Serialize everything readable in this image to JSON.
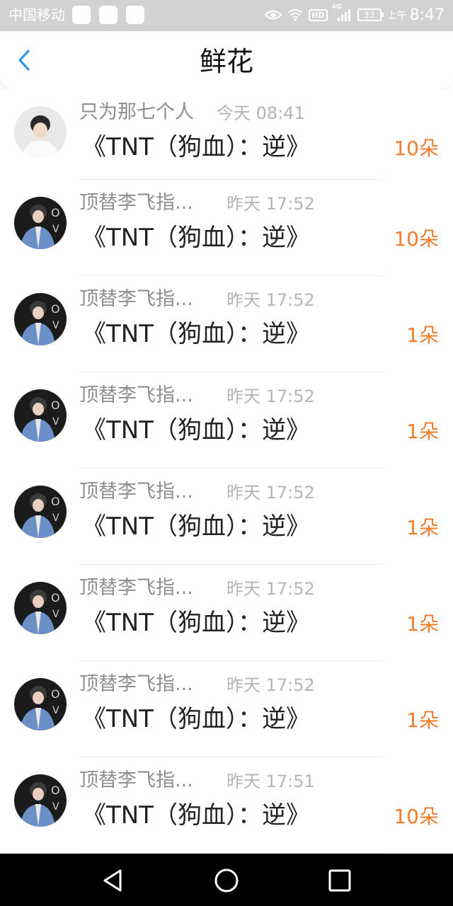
{
  "status_bar": {
    "carrier": "中国移动",
    "hd_badge": "HD",
    "network": "4G",
    "battery": "33",
    "ampm": "上午",
    "time": "8:47",
    "icons": [
      "notification-square-icon",
      "eye-icon",
      "wifi-icon",
      "signal-icon",
      "battery-icon"
    ]
  },
  "header": {
    "title": "鲜花",
    "back_icon": "chevron-left-icon"
  },
  "colors": {
    "accent_blue": "#2b9af3",
    "count_orange": "#f07c2c",
    "status_bar_bg": "#d2d2d2",
    "nav_bar_bg": "#000000"
  },
  "records": [
    {
      "name": "只为那七个人",
      "time": "今天 08:41",
      "work": "《TNT（狗血）：逆》",
      "count": "10朵",
      "avatar": "light"
    },
    {
      "name": "顶替李飞指...",
      "time": "昨天 17:52",
      "work": "《TNT（狗血）：逆》",
      "count": "10朵",
      "avatar": "dark"
    },
    {
      "name": "顶替李飞指...",
      "time": "昨天 17:52",
      "work": "《TNT（狗血）：逆》",
      "count": "1朵",
      "avatar": "dark"
    },
    {
      "name": "顶替李飞指...",
      "time": "昨天 17:52",
      "work": "《TNT（狗血）：逆》",
      "count": "1朵",
      "avatar": "dark"
    },
    {
      "name": "顶替李飞指...",
      "time": "昨天 17:52",
      "work": "《TNT（狗血）：逆》",
      "count": "1朵",
      "avatar": "dark"
    },
    {
      "name": "顶替李飞指...",
      "time": "昨天 17:52",
      "work": "《TNT（狗血）：逆》",
      "count": "1朵",
      "avatar": "dark"
    },
    {
      "name": "顶替李飞指...",
      "time": "昨天 17:52",
      "work": "《TNT（狗血）：逆》",
      "count": "1朵",
      "avatar": "dark"
    },
    {
      "name": "顶替李飞指...",
      "time": "昨天 17:51",
      "work": "《TNT（狗血）：逆》",
      "count": "10朵",
      "avatar": "dark"
    }
  ],
  "nav_bar": {
    "icons": [
      "back-triangle-icon",
      "home-circle-icon",
      "recents-square-icon"
    ]
  }
}
